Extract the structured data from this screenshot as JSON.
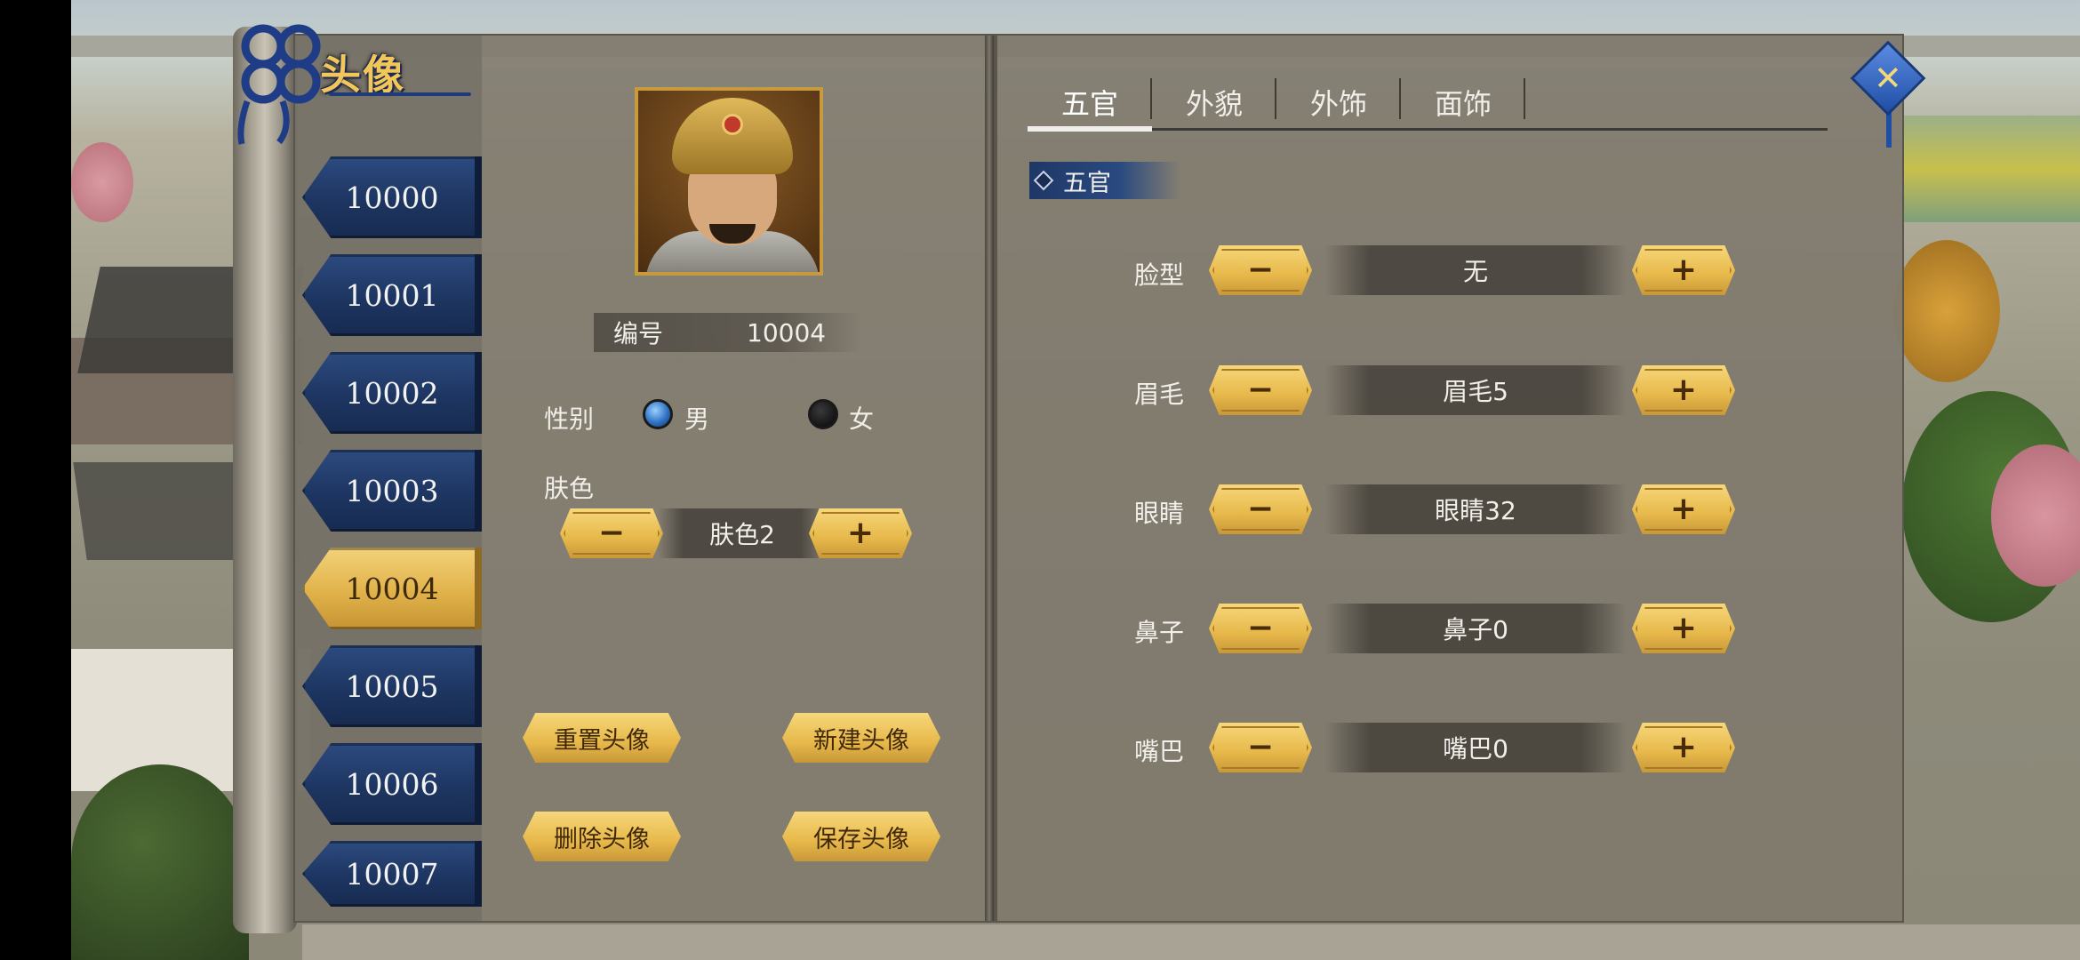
{
  "title": "头像",
  "avatar_list": [
    {
      "id": "10000",
      "active": false
    },
    {
      "id": "10001",
      "active": false
    },
    {
      "id": "10002",
      "active": false
    },
    {
      "id": "10003",
      "active": false
    },
    {
      "id": "10004",
      "active": true
    },
    {
      "id": "10005",
      "active": false
    },
    {
      "id": "10006",
      "active": false
    },
    {
      "id": "10007",
      "active": false
    }
  ],
  "profile": {
    "number_label": "编号",
    "number_value": "10004",
    "gender_label": "性别",
    "gender_options": [
      {
        "label": "男",
        "selected": true
      },
      {
        "label": "女",
        "selected": false
      }
    ],
    "skin_label": "肤色",
    "skin_value": "肤色2"
  },
  "actions": {
    "reset": "重置头像",
    "new": "新建头像",
    "delete": "删除头像",
    "save": "保存头像"
  },
  "tabs": [
    {
      "label": "五官",
      "active": true
    },
    {
      "label": "外貌",
      "active": false
    },
    {
      "label": "外饰",
      "active": false
    },
    {
      "label": "面饰",
      "active": false
    }
  ],
  "section_title": "五官",
  "features": [
    {
      "label": "脸型",
      "value": "无"
    },
    {
      "label": "眉毛",
      "value": "眉毛5"
    },
    {
      "label": "眼睛",
      "value": "眼睛32"
    },
    {
      "label": "鼻子",
      "value": "鼻子0"
    },
    {
      "label": "嘴巴",
      "value": "嘴巴0"
    }
  ],
  "icons": {
    "minus": "−",
    "plus": "+",
    "close": "✕"
  },
  "colors": {
    "gold": "#e7b84a",
    "navy": "#1d3561",
    "panel": "#827c70"
  }
}
